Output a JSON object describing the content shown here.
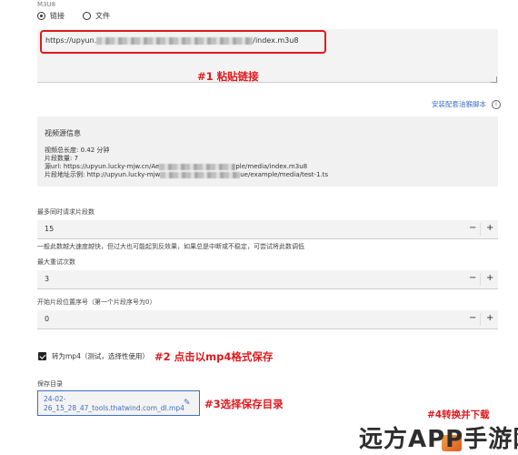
{
  "form": {
    "m3u8_label": "M3U8",
    "source_options": [
      {
        "label": "链接",
        "selected": true
      },
      {
        "label": "文件",
        "selected": false
      }
    ],
    "url_prefix": "https://upyun.",
    "url_suffix": "/index.m3u8"
  },
  "annotations": {
    "step1": "#1 粘贴链接",
    "step2": "#2 点击以mp4格式保存",
    "step3": "#3选择保存目录",
    "step4": "#4转换并下载"
  },
  "install_script_link": "安装配套油猴脚本",
  "info": {
    "title": "视频源信息",
    "duration": "视频总长度: 0.42 分钟",
    "segments": "片段数量: 7",
    "source_url_prefix": "源url: https://upyun.lucky-mjw.cn/Ae",
    "source_url_suffix": "ple/media/index.m3u8",
    "segment_sample_prefix": "片段地址示例: http://upyun.lucky-mjw",
    "segment_sample_suffix": "ue/example/media/test-1.ts"
  },
  "concurrency": {
    "label": "最多同时请求片段数",
    "value": "15",
    "hint": "一般此数越大速度越快，但过大也可能起到反效果，如果总是中断或不稳定，可尝试将此数调低"
  },
  "retries": {
    "label": "最大重试次数",
    "value": "3"
  },
  "start_index": {
    "label": "开始片段位置序号（第一个片段序号为0）",
    "value": "0"
  },
  "convert": {
    "label": "转为mp4（测试，选择性使用）",
    "checked": true
  },
  "save": {
    "label": "保存目录",
    "line1": "24-02-",
    "line2": "26_15_28_47_tools.thatwind.com_dl.mp4"
  },
  "stepper": {
    "minus": "−",
    "plus": "+"
  },
  "watermark": "远方APP手游网"
}
